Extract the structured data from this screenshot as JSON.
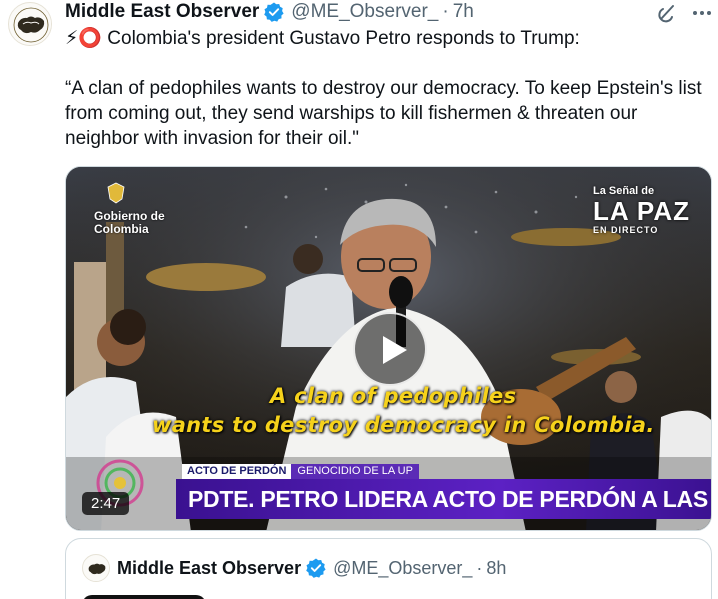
{
  "post": {
    "author_name": "Middle East Observer",
    "handle": "@ME_Observer_",
    "separator": "·",
    "time": "7h",
    "text": "⚡⭕ Colombia's president Gustavo Petro responds to Trump:\n\n“A clan of pedophiles wants to destroy our democracy. To keep Epstein's list from coming out, they send warships to kill fishermen & threaten our neighbor with invasion for their oil.\""
  },
  "video": {
    "duration": "2:47",
    "subtitle_line1": "A clan of pedophiles",
    "subtitle_line2": "wants to destroy democracy in Colombia.",
    "gov_logo_line1": "Gobierno de",
    "gov_logo_line2": "Colombia",
    "channel_line1": "La Señal de",
    "channel_line2": "LA PAZ",
    "channel_line3": "EN DIRECTO",
    "ticker_tag": "ACTO DE PERDÓN",
    "ticker_topic": "GENOCIDIO DE LA UP",
    "ticker_headline": "PDTE. PETRO LIDERA ACTO DE PERDÓN A LAS VÍCTIMAS",
    "accent_colors": {
      "subtitle": "#f6d21b",
      "ticker": "#5c21c4"
    }
  },
  "quoted_post": {
    "author_name": "Middle East Observer",
    "handle": "@ME_Observer_",
    "separator": "·",
    "time": "8h"
  },
  "icons": {
    "verified": "verified-badge-icon",
    "grok": "grok-icon",
    "more": "more-options-icon",
    "play": "play-icon"
  }
}
